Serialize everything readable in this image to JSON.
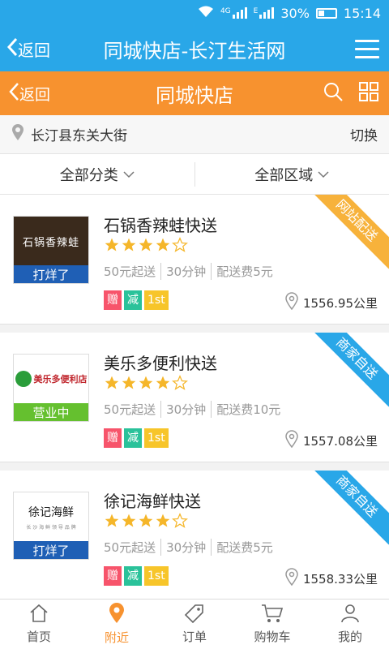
{
  "status_bar": {
    "network": "4G",
    "network2": "E",
    "battery": "30%",
    "time": "15:14"
  },
  "top_bar": {
    "back_label": "返回",
    "title": "同城快店-长汀生活网",
    "menu_icon": "hamburger-menu-icon"
  },
  "sub_bar": {
    "back_label": "返回",
    "title": "同城快店"
  },
  "location": {
    "address": "长汀县东关大街",
    "switch_label": "切换"
  },
  "filters": {
    "category": "全部分类",
    "region": "全部区域"
  },
  "shops": [
    {
      "name": "石锅香辣蛙快送",
      "logo_text": "石锅香辣蛙",
      "status": "打烊了",
      "rating": 4,
      "min_order": "50元起送",
      "time": "30分钟",
      "fee": "配送费5元",
      "tags": [
        "赠",
        "减",
        "1st"
      ],
      "distance": "1556.95公里",
      "ribbon": "网站配送"
    },
    {
      "name": "美乐多便利快送",
      "logo_text": "美乐多便利店",
      "status": "营业中",
      "rating": 4,
      "min_order": "50元起送",
      "time": "30分钟",
      "fee": "配送费10元",
      "tags": [
        "赠",
        "减",
        "1st"
      ],
      "distance": "1557.08公里",
      "ribbon": "商家自送"
    },
    {
      "name": "徐记海鲜快送",
      "logo_text": "徐记海鲜",
      "logo_sub": "长 沙 海 鲜 领 导 品 牌",
      "status": "打烊了",
      "rating": 4,
      "min_order": "50元起送",
      "time": "30分钟",
      "fee": "配送费5元",
      "tags": [
        "赠",
        "减",
        "1st"
      ],
      "distance": "1558.33公里",
      "ribbon": "商家自送"
    }
  ],
  "bottom_nav": [
    {
      "label": "首页",
      "icon": "home-icon"
    },
    {
      "label": "附近",
      "icon": "location-pin-icon",
      "active": true
    },
    {
      "label": "订单",
      "icon": "tag-icon"
    },
    {
      "label": "购物车",
      "icon": "cart-icon"
    },
    {
      "label": "我的",
      "icon": "user-icon"
    }
  ],
  "colors": {
    "primary_blue": "#29a7e8",
    "accent_orange": "#f7922f",
    "star": "#f5b62a"
  }
}
